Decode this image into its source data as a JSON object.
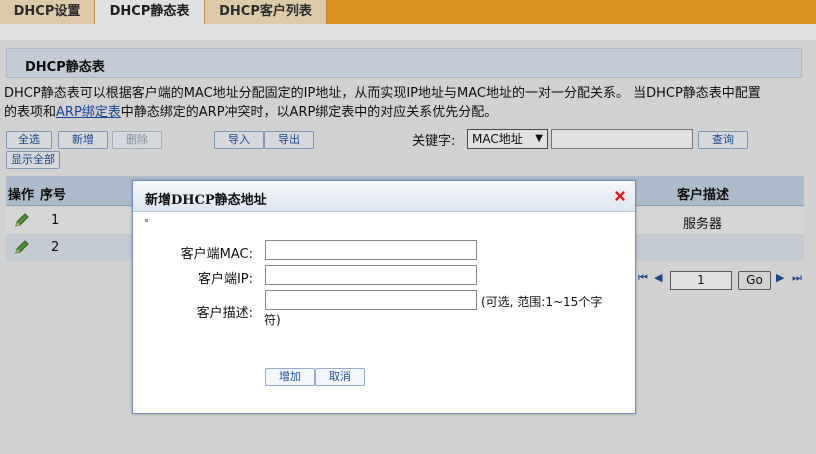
{
  "tabs": [
    {
      "label": "DHCP设置"
    },
    {
      "label": "DHCP静态表"
    },
    {
      "label": "DHCP客户列表"
    }
  ],
  "section": {
    "title": "DHCP静态表",
    "desc_line1": "DHCP静态表可以根据客户端的MAC地址分配固定的IP地址，从而实现IP地址与MAC地址的一对一分配关系。   当DHCP静态表中配置",
    "desc_line2_pre": "的表项和",
    "desc_link": "ARP绑定表",
    "desc_line2_post": "中静态绑定的ARP冲突时，以ARP绑定表中的对应关系优先分配。"
  },
  "toolbar": {
    "select_all": "全选",
    "add": "新增",
    "delete": "删除",
    "import": "导入",
    "export": "导出",
    "keyword_label": "关键字:",
    "keyword_option": "MAC地址",
    "search": "查询",
    "show_all": "显示全部"
  },
  "table": {
    "headers": {
      "op": "操作",
      "seq": "序号",
      "desc": "客户描述"
    },
    "rows": [
      {
        "seq": "1",
        "desc": "服务器"
      },
      {
        "seq": "2",
        "desc": ""
      }
    ]
  },
  "pager": {
    "page": "1",
    "go": "Go",
    "first": "⏮",
    "prev": "◀",
    "next": "▶",
    "last": "⏭"
  },
  "modal": {
    "title": "新增DHCP静态地址",
    "mac_label": "客户端MAC:",
    "ip_label": "客户端IP:",
    "desc_label": "客户描述:",
    "desc_hint": "(可选, 范围:1~15个字",
    "desc_hint2": "符)",
    "add_button": "增加",
    "cancel_button": "取消"
  }
}
